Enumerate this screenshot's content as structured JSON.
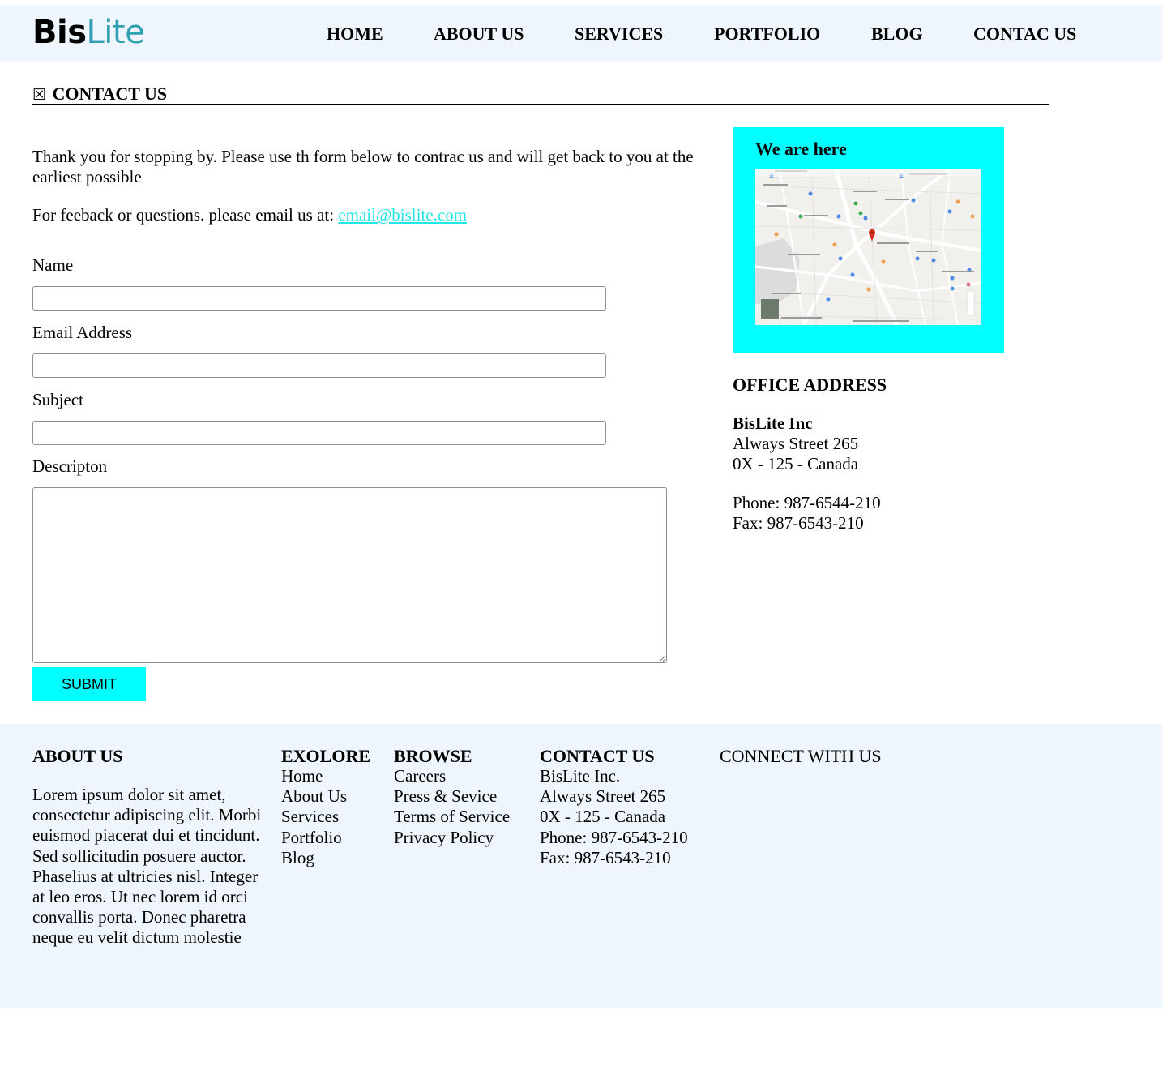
{
  "brand": {
    "logo_part1": "Bis",
    "logo_part2": "Lite"
  },
  "nav": {
    "items": [
      {
        "label": "HOME"
      },
      {
        "label": "ABOUT US"
      },
      {
        "label": "SERVICES"
      },
      {
        "label": "PORTFOLIO"
      },
      {
        "label": "BLOG"
      },
      {
        "label": "CONTAC US"
      }
    ]
  },
  "page": {
    "title_icon": "☒",
    "title": "CONTACT US",
    "intro": "Thank you for stopping by. Please use th form below to contrac us and will get back to you at the earliest possible",
    "email_prefix": "For feeback or questions. please email us at: ",
    "email": "email@bislite.com"
  },
  "form": {
    "name_label": "Name",
    "email_label": "Email Address",
    "subject_label": "Subject",
    "description_label": "Descripton",
    "name_value": "",
    "email_value": "",
    "subject_value": "",
    "description_value": "",
    "submit_label": "SUBMIT"
  },
  "map": {
    "title": "We are here"
  },
  "office": {
    "title": "OFFICE ADDRESS",
    "company": "BisLite Inc",
    "street": "Always Street 265",
    "city": "0X - 125 - Canada",
    "phone": "Phone: 987-6544-210",
    "fax": "Fax: 987-6543-210"
  },
  "footer": {
    "about": {
      "title": "ABOUT US",
      "text": "Lorem ipsum dolor sit amet, consectetur adipiscing elit. Morbi euismod piacerat dui et tincidunt. Sed sollicitudin posuere auctor. Phaselius at ultricies nisl. Integer at leo eros. Ut nec lorem id orci convallis porta. Donec pharetra neque eu velit dictum molestie"
    },
    "explore": {
      "title": "EXOLORE",
      "items": [
        "Home",
        "About Us",
        "Services",
        "Portfolio",
        "Blog"
      ]
    },
    "browse": {
      "title": "BROWSE",
      "items": [
        "Careers",
        "Press & Sevice",
        "Terms of Service",
        "Privacy Policy"
      ]
    },
    "contact": {
      "title": "CONTACT US",
      "lines": [
        "BisLite Inc.",
        "Always Street 265",
        "0X - 125 - Canada",
        "Phone: 987-6543-210",
        "Fax: 987-6543-210"
      ]
    },
    "connect": {
      "title": "CONNECT WITH US"
    }
  },
  "colors": {
    "header_bg": "#eef5fc",
    "footer_bg": "#eef5fc",
    "accent_cyan": "#00ffff",
    "link_color": "#22e5ea",
    "logo_teal": "#2fa1b3"
  }
}
